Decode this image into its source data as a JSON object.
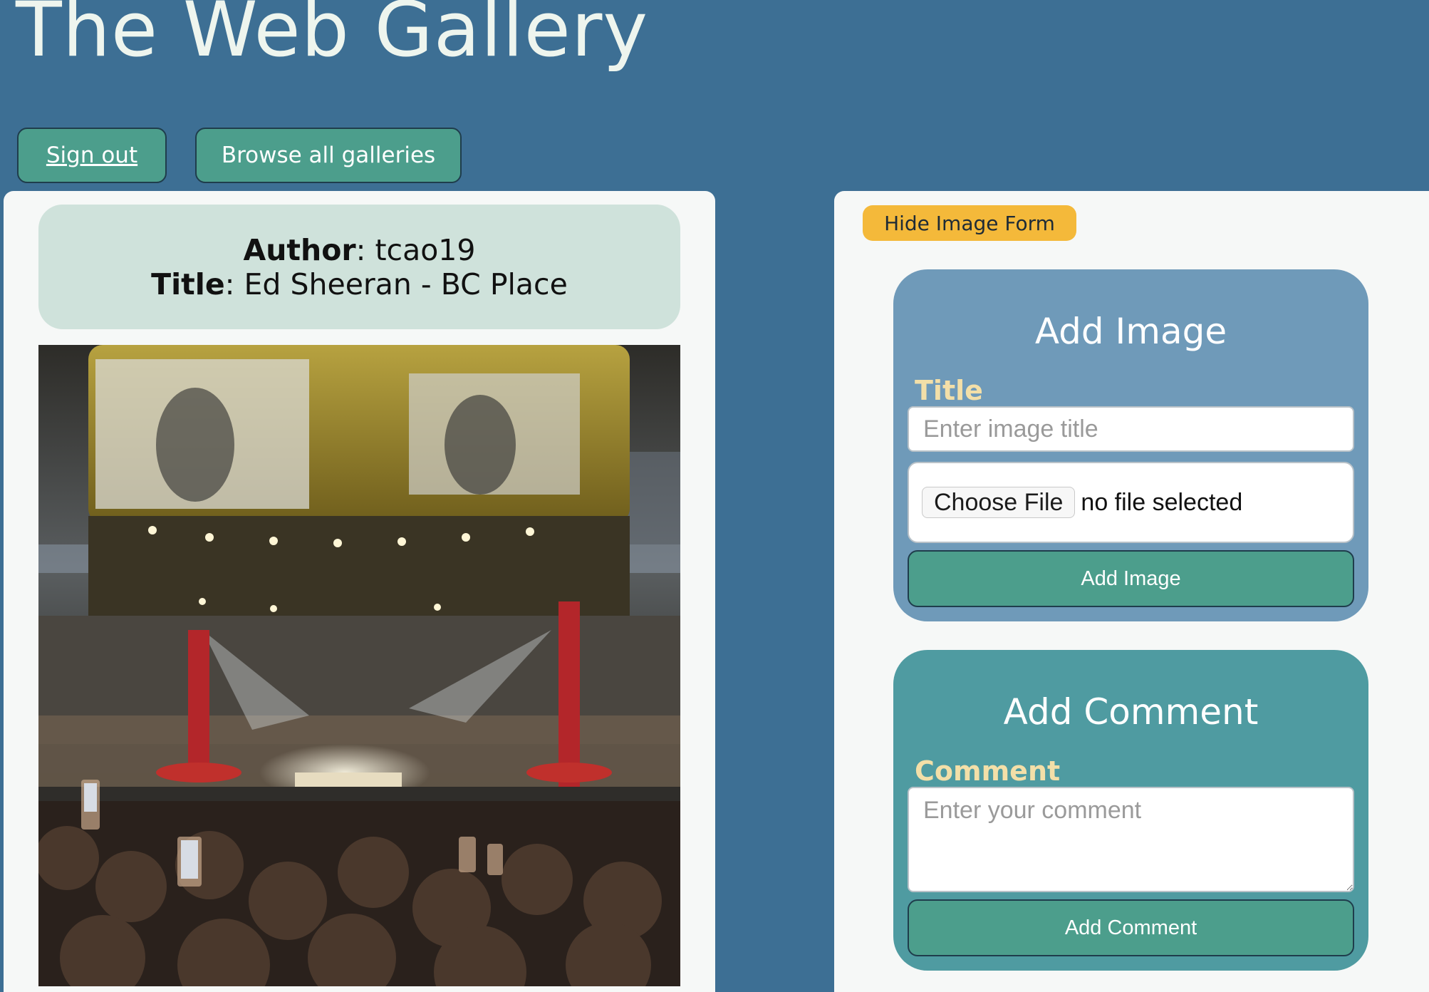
{
  "site": {
    "title": "The Web Gallery"
  },
  "nav": {
    "sign_out": "Sign out",
    "browse_all": "Browse all galleries"
  },
  "image_info": {
    "author_label": "Author",
    "author": "tcao19",
    "title_label": "Title",
    "title": "Ed Sheeran - BC Place"
  },
  "image_form_toggle": {
    "label": "Hide Image Form"
  },
  "add_image_form": {
    "heading": "Add Image",
    "title_label": "Title",
    "title_placeholder": "Enter image title",
    "choose_file": "Choose File",
    "file_status": "no file selected",
    "submit": "Add Image"
  },
  "add_comment_form": {
    "heading": "Add Comment",
    "comment_label": "Comment",
    "comment_placeholder": "Enter your comment",
    "submit": "Add Comment"
  },
  "colors": {
    "page_background": "#3d6f94",
    "button_green": "#4c9e8c",
    "toggle_yellow": "#f4b93a",
    "image_form_blue": "#6f9ab9",
    "comment_form_teal": "#4f9ba1",
    "label_cream": "#f3dfa8"
  }
}
